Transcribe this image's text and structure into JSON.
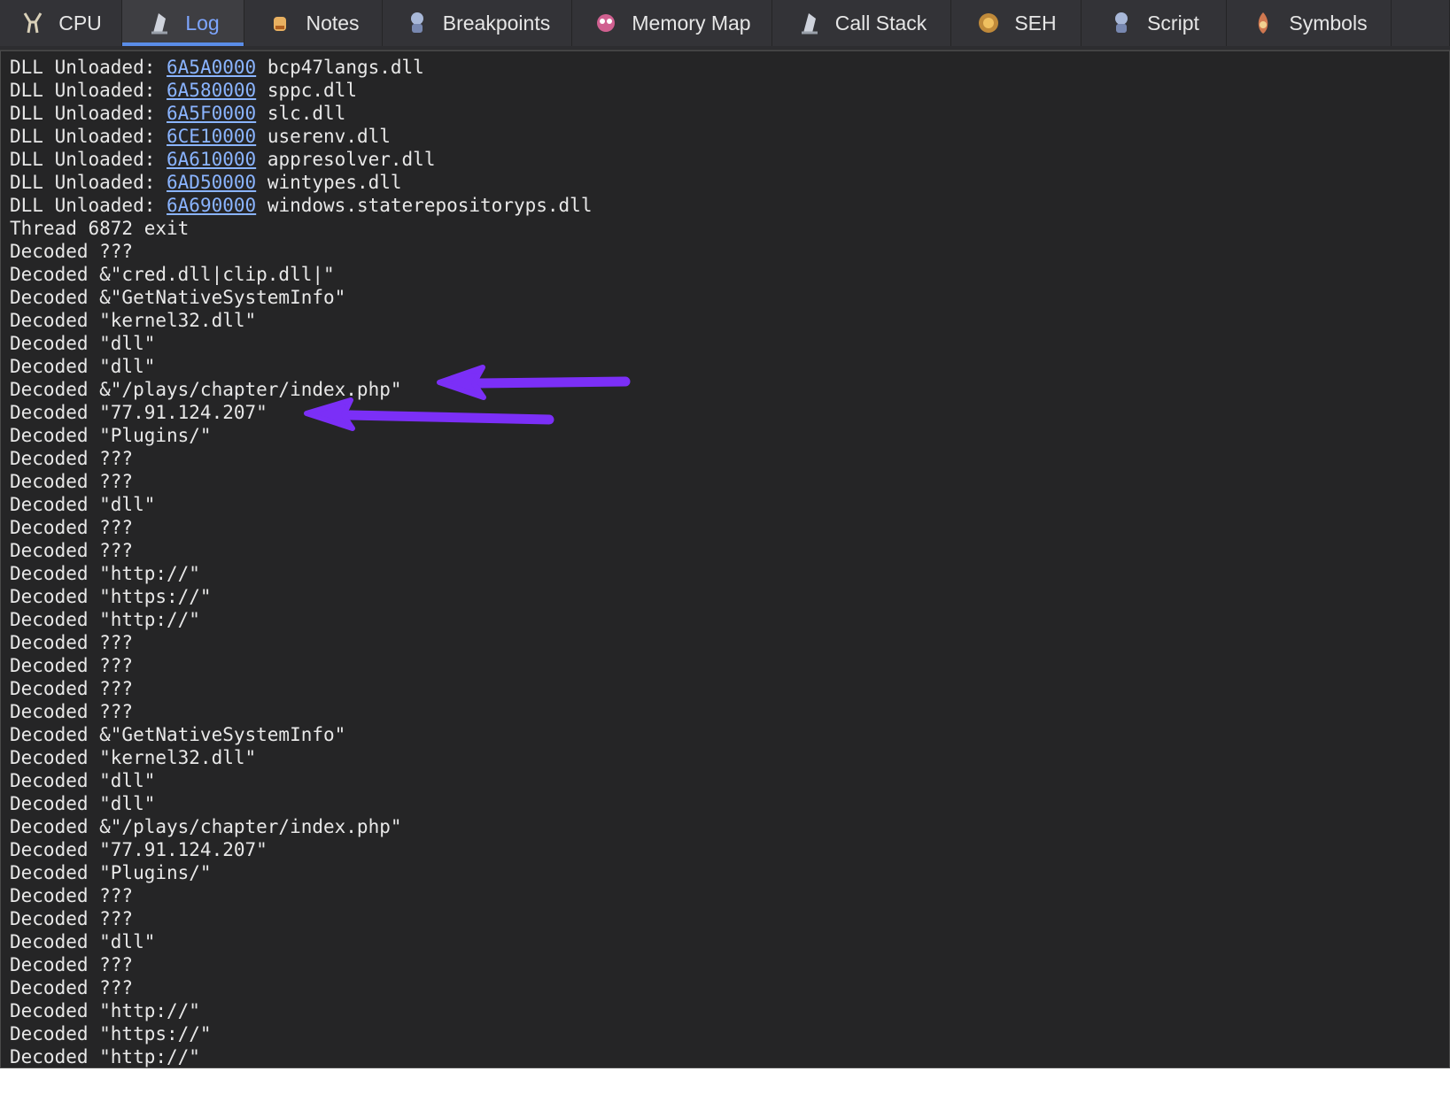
{
  "tabs": [
    {
      "label": "CPU",
      "icon": "cpu-icon",
      "active": false
    },
    {
      "label": "Log",
      "icon": "log-icon",
      "active": true
    },
    {
      "label": "Notes",
      "icon": "notes-icon",
      "active": false
    },
    {
      "label": "Breakpoints",
      "icon": "breakpoints-icon",
      "active": false
    },
    {
      "label": "Memory Map",
      "icon": "memory-map-icon",
      "active": false
    },
    {
      "label": "Call Stack",
      "icon": "call-stack-icon",
      "active": false
    },
    {
      "label": "SEH",
      "icon": "seh-icon",
      "active": false
    },
    {
      "label": "Script",
      "icon": "script-icon",
      "active": false
    },
    {
      "label": "Symbols",
      "icon": "symbols-icon",
      "active": false
    }
  ],
  "log": {
    "lines": [
      {
        "prefix": "DLL Unloaded: ",
        "addr": "6A5A0000",
        "suffix": " bcp47langs.dll"
      },
      {
        "prefix": "DLL Unloaded: ",
        "addr": "6A580000",
        "suffix": " sppc.dll"
      },
      {
        "prefix": "DLL Unloaded: ",
        "addr": "6A5F0000",
        "suffix": " slc.dll"
      },
      {
        "prefix": "DLL Unloaded: ",
        "addr": "6CE10000",
        "suffix": " userenv.dll"
      },
      {
        "prefix": "DLL Unloaded: ",
        "addr": "6A610000",
        "suffix": " appresolver.dll"
      },
      {
        "prefix": "DLL Unloaded: ",
        "addr": "6AD50000",
        "suffix": " wintypes.dll"
      },
      {
        "prefix": "DLL Unloaded: ",
        "addr": "6A690000",
        "suffix": " windows.staterepositoryps.dll"
      },
      {
        "prefix": "Thread 6872 exit"
      },
      {
        "prefix": "Decoded ???"
      },
      {
        "prefix": "Decoded &\"cred.dll|clip.dll|\""
      },
      {
        "prefix": "Decoded &\"GetNativeSystemInfo\""
      },
      {
        "prefix": "Decoded \"kernel32.dll\""
      },
      {
        "prefix": "Decoded \"dll\""
      },
      {
        "prefix": "Decoded \"dll\""
      },
      {
        "prefix": "Decoded &\"/plays/chapter/index.php\""
      },
      {
        "prefix": "Decoded \"77.91.124.207\""
      },
      {
        "prefix": "Decoded \"Plugins/\""
      },
      {
        "prefix": "Decoded ???"
      },
      {
        "prefix": "Decoded ???"
      },
      {
        "prefix": "Decoded \"dll\""
      },
      {
        "prefix": "Decoded ???"
      },
      {
        "prefix": "Decoded ???"
      },
      {
        "prefix": "Decoded \"http://\""
      },
      {
        "prefix": "Decoded \"https://\""
      },
      {
        "prefix": "Decoded \"http://\""
      },
      {
        "prefix": "Decoded ???"
      },
      {
        "prefix": "Decoded ???"
      },
      {
        "prefix": "Decoded ???"
      },
      {
        "prefix": "Decoded ???"
      },
      {
        "prefix": "Decoded &\"GetNativeSystemInfo\""
      },
      {
        "prefix": "Decoded \"kernel32.dll\""
      },
      {
        "prefix": "Decoded \"dll\""
      },
      {
        "prefix": "Decoded \"dll\""
      },
      {
        "prefix": "Decoded &\"/plays/chapter/index.php\""
      },
      {
        "prefix": "Decoded \"77.91.124.207\""
      },
      {
        "prefix": "Decoded \"Plugins/\""
      },
      {
        "prefix": "Decoded ???"
      },
      {
        "prefix": "Decoded ???"
      },
      {
        "prefix": "Decoded \"dll\""
      },
      {
        "prefix": "Decoded ???"
      },
      {
        "prefix": "Decoded ???"
      },
      {
        "prefix": "Decoded \"http://\""
      },
      {
        "prefix": "Decoded \"https://\""
      },
      {
        "prefix": "Decoded \"http://\""
      }
    ]
  },
  "colors": {
    "background": "#252526",
    "text": "#e8e8e8",
    "address_link": "#8ab4ff",
    "active_tab_text": "#7ea6ff",
    "annotation_arrow": "#7b2ff7"
  }
}
